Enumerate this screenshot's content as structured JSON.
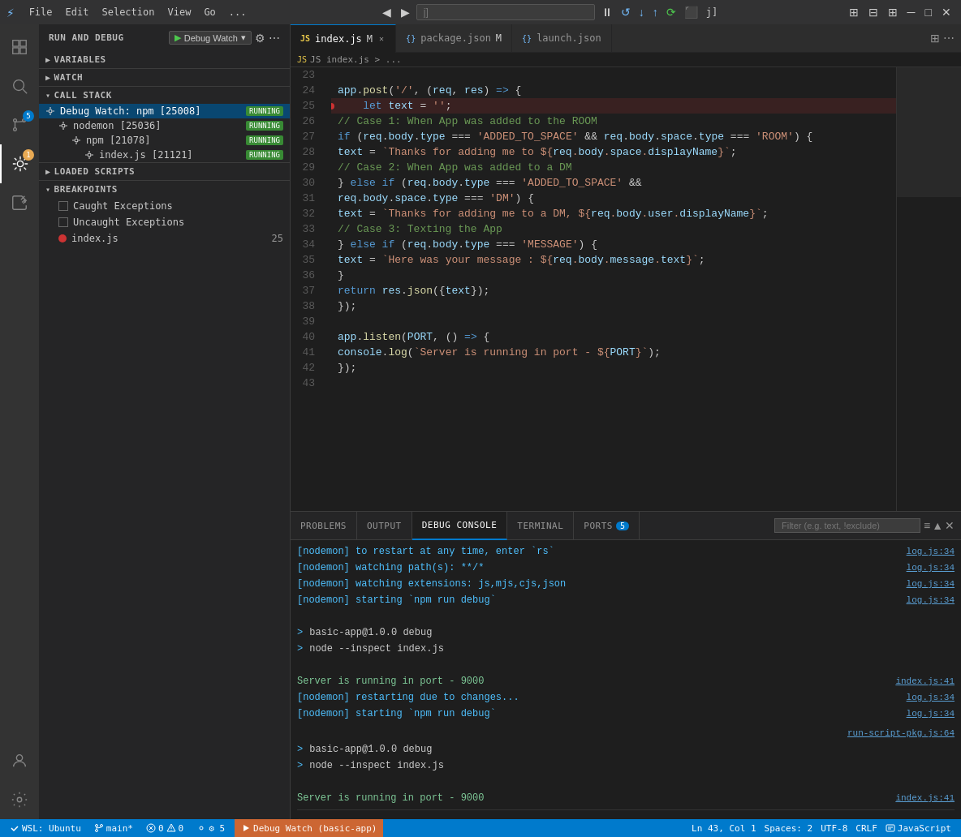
{
  "titlebar": {
    "icon": "⚡",
    "menus": [
      "File",
      "Edit",
      "Selection",
      "View",
      "Go",
      "..."
    ],
    "back_label": "◀",
    "forward_label": "▶",
    "search_placeholder": "j]",
    "debug_controls": [
      "⏸",
      "↺",
      "↓",
      "↑",
      "⟳",
      "⬛"
    ],
    "window_controls": [
      "─",
      "□",
      "✕"
    ]
  },
  "activity_bar": {
    "items": [
      {
        "name": "explorer",
        "icon": "⎘",
        "active": false
      },
      {
        "name": "search",
        "icon": "🔍",
        "active": false
      },
      {
        "name": "source-control",
        "icon": "⑂",
        "badge": "5",
        "active": false
      },
      {
        "name": "debug",
        "icon": "🐛",
        "badge": "1",
        "active": true
      },
      {
        "name": "extensions",
        "icon": "⊞",
        "active": false
      }
    ],
    "bottom_items": [
      {
        "name": "account",
        "icon": "👤"
      },
      {
        "name": "settings",
        "icon": "⚙"
      }
    ]
  },
  "sidebar": {
    "header": "Run and Debug",
    "debug_config": "Debug Watch",
    "variables_section": "VARIABLES",
    "watch_section": "WATCH",
    "callstack_section": "CALL STACK",
    "callstack_items": [
      {
        "name": "Debug Watch: npm [25008]",
        "status": "RUNNING",
        "level": 0
      },
      {
        "name": "nodemon [25036]",
        "status": "RUNNING",
        "level": 1
      },
      {
        "name": "npm [21078]",
        "status": "RUNNING",
        "level": 2
      },
      {
        "name": "index.js [21121]",
        "status": "RUNNING",
        "level": 3
      }
    ],
    "loaded_scripts_section": "LOADED SCRIPTS",
    "breakpoints_section": "BREAKPOINTS",
    "breakpoint_items": [
      {
        "label": "Caught Exceptions",
        "checked": false,
        "type": "exception"
      },
      {
        "label": "Uncaught Exceptions",
        "checked": false,
        "type": "exception"
      },
      {
        "label": "index.js",
        "checked": true,
        "type": "file",
        "line": "25"
      }
    ]
  },
  "editor": {
    "tabs": [
      {
        "label": "index.js",
        "modified": true,
        "active": true,
        "icon": "JS"
      },
      {
        "label": "package.json",
        "modified": true,
        "active": false,
        "icon": "{}"
      },
      {
        "label": "launch.json",
        "modified": false,
        "active": false,
        "icon": "{}"
      }
    ],
    "breadcrumb": "JS index.js > ...",
    "lines": [
      {
        "num": 23,
        "content": ""
      },
      {
        "num": 24,
        "content": "app.post('/', (req, res) => {",
        "type": "code"
      },
      {
        "num": 25,
        "content": "    let text = '';",
        "type": "code",
        "breakpoint": true
      },
      {
        "num": 26,
        "content": "    // Case 1: When App was added to the ROOM",
        "type": "comment"
      },
      {
        "num": 27,
        "content": "    if (req.body.type === 'ADDED_TO_SPACE' && req.body.space.type === 'ROOM') {",
        "type": "code"
      },
      {
        "num": 28,
        "content": "        text = `Thanks for adding me to ${req.body.space.displayName}`;",
        "type": "code"
      },
      {
        "num": 29,
        "content": "    // Case 2: When App was added to a DM",
        "type": "comment"
      },
      {
        "num": 30,
        "content": "    } else if (req.body.type === 'ADDED_TO_SPACE' &&",
        "type": "code"
      },
      {
        "num": 31,
        "content": "        req.body.space.type === 'DM') {",
        "type": "code"
      },
      {
        "num": 32,
        "content": "        text = `Thanks for adding me to a DM, ${req.body.user.displayName}`;",
        "type": "code"
      },
      {
        "num": 33,
        "content": "    // Case 3: Texting the App",
        "type": "comment"
      },
      {
        "num": 34,
        "content": "    } else if (req.body.type === 'MESSAGE') {",
        "type": "code"
      },
      {
        "num": 35,
        "content": "        text = `Here was your message : ${req.body.message.text}`;",
        "type": "code"
      },
      {
        "num": 36,
        "content": "    }",
        "type": "code"
      },
      {
        "num": 37,
        "content": "    return res.json({text});",
        "type": "code"
      },
      {
        "num": 38,
        "content": "});",
        "type": "code"
      },
      {
        "num": 39,
        "content": ""
      },
      {
        "num": 40,
        "content": "app.listen(PORT, () => {",
        "type": "code"
      },
      {
        "num": 41,
        "content": "    console.log(`Server is running in port - ${PORT}`);",
        "type": "code"
      },
      {
        "num": 42,
        "content": "});",
        "type": "code"
      },
      {
        "num": 43,
        "content": ""
      }
    ]
  },
  "panel": {
    "tabs": [
      {
        "label": "PROBLEMS",
        "active": false
      },
      {
        "label": "OUTPUT",
        "active": false
      },
      {
        "label": "DEBUG CONSOLE",
        "active": true
      },
      {
        "label": "TERMINAL",
        "active": false
      },
      {
        "label": "PORTS",
        "active": false,
        "badge": "5"
      }
    ],
    "filter_placeholder": "Filter (e.g. text, !exclude)",
    "console_lines": [
      {
        "text": "[nodemon] to restart at any time, enter `rs`",
        "ref": "log.js:34"
      },
      {
        "text": "[nodemon] watching path(s): **/*",
        "ref": "log.js:34"
      },
      {
        "text": "[nodemon] watching extensions: js,mjs,cjs,json",
        "ref": "log.js:34"
      },
      {
        "text": "[nodemon] starting `npm run debug`",
        "ref": "log.js:34"
      },
      {
        "text": "",
        "ref": ""
      },
      {
        "text": "> basic-app@1.0.0 debug",
        "ref": "",
        "prefix": ">"
      },
      {
        "text": "> node --inspect index.js",
        "ref": "",
        "prefix": ">"
      },
      {
        "text": "",
        "ref": ""
      },
      {
        "text": "Server is running in port - 9000",
        "ref": "index.js:41"
      },
      {
        "text": "[nodemon] restarting due to changes...",
        "ref": "log.js:34"
      },
      {
        "text": "[nodemon] starting `npm run debug`",
        "ref": "log.js:34"
      },
      {
        "text": "",
        "ref": ""
      },
      {
        "text": "> basic-app@1.0.0 debug",
        "ref": "",
        "prefix": ">"
      },
      {
        "text": "> node --inspect index.js",
        "ref": "",
        "prefix": ">"
      },
      {
        "text": "",
        "ref": ""
      },
      {
        "text": "Server is running in port - 9000",
        "ref": "index.js:41"
      }
    ],
    "input_arrow": ">"
  },
  "statusbar": {
    "wsl": "WSL: Ubuntu",
    "branch": "main*",
    "errors": "0",
    "warnings": "0",
    "debug_processes": "5",
    "debug_label": "Debug Watch (basic-app)",
    "cursor": "Ln 43, Col 1",
    "spaces": "Spaces: 2",
    "encoding": "UTF-8",
    "line_ending": "CRLF",
    "language": "JavaScript"
  }
}
